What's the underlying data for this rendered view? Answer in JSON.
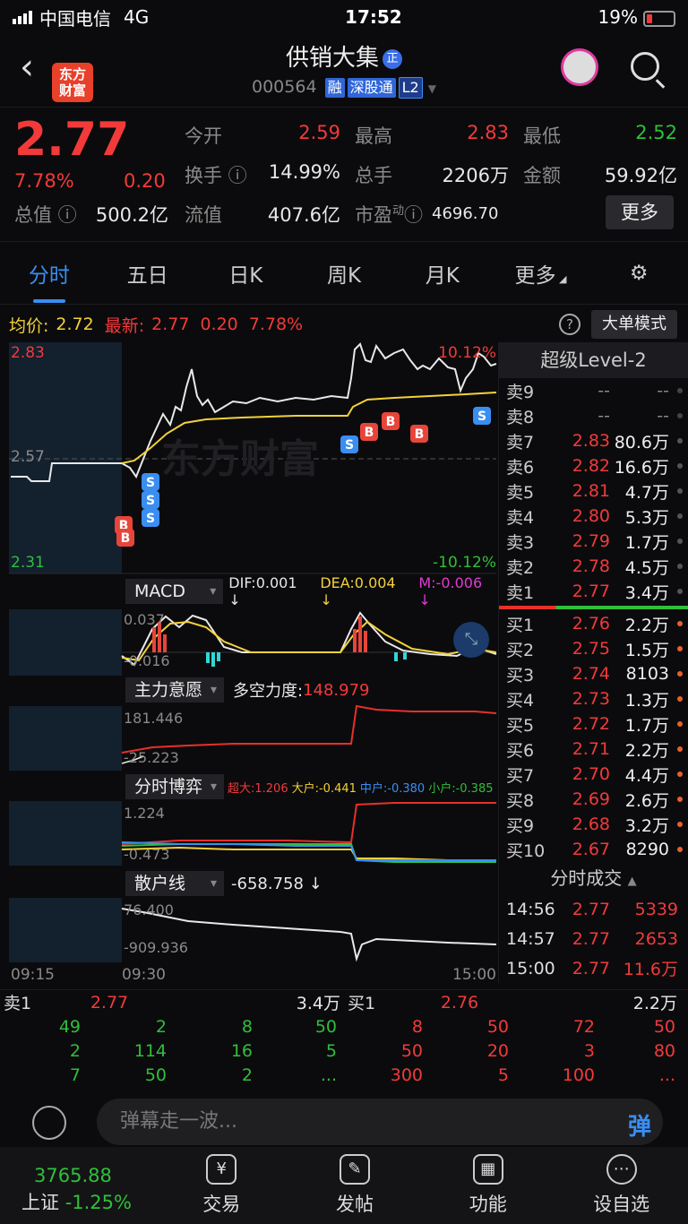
{
  "status": {
    "carrier": "中国电信",
    "network": "4G",
    "time": "17:52",
    "battery": "19%"
  },
  "header": {
    "logo_line1": "东方",
    "logo_line2": "财富",
    "name": "供销大集",
    "name_tag": "正",
    "code": "000564",
    "tags": [
      "融",
      "深股通",
      "L2"
    ]
  },
  "quote": {
    "price": "2.77",
    "pct": "7.78%",
    "change": "0.20",
    "open_label": "今开",
    "open": "2.59",
    "high_label": "最高",
    "high": "2.83",
    "low_label": "最低",
    "low": "2.52",
    "turnover_label": "换手",
    "turnover": "14.99%",
    "vol_label": "总手",
    "vol": "2206万",
    "amount_label": "金额",
    "amount": "59.92亿",
    "mcap_label": "总值",
    "mcap": "500.2亿",
    "float_label": "流值",
    "float": "407.6亿",
    "pe_label": "市盈",
    "pe_sup": "动",
    "pe": "4696.70",
    "more": "更多"
  },
  "tabs": [
    "分时",
    "五日",
    "日K",
    "周K",
    "月K",
    "更多",
    "⚙"
  ],
  "avgline": {
    "avg_label": "均价:",
    "avg": "2.72",
    "last_label": "最新:",
    "last": "2.77",
    "chg": "0.20",
    "pct": "7.78%",
    "help": "?",
    "mode": "大单模式"
  },
  "chart": {
    "ymax": "2.83",
    "ymid": "2.57",
    "ymin": "2.31",
    "pmax": "10.12%",
    "pmin": "-10.12%",
    "watermark": "东方财富",
    "times": [
      "09:15",
      "09:30",
      "15:00"
    ]
  },
  "macd": {
    "name": "MACD",
    "dif": "DIF:0.001 ↓",
    "dea": "DEA:0.004 ↓",
    "m": "M:-0.006 ↓",
    "top": "0.037",
    "bottom": "-0.016"
  },
  "zlyy": {
    "name": "主力意愿",
    "label": "多空力度:",
    "value": "148.979",
    "top": "181.446",
    "bottom": "-25.223"
  },
  "fsby": {
    "name": "分时博弈",
    "super": "超大:1.206",
    "big": "大户:-0.441",
    "mid": "中户:-0.380",
    "small": "小户:-0.385",
    "top": "1.224",
    "bottom": "-0.473"
  },
  "shx": {
    "name": "散户线",
    "value": "-658.758 ↓",
    "top": "76.400",
    "bottom": "-909.936"
  },
  "book": {
    "title": "超级Level-2",
    "asks": [
      {
        "l": "卖9",
        "p": "--",
        "v": "--"
      },
      {
        "l": "卖8",
        "p": "--",
        "v": "--"
      },
      {
        "l": "卖7",
        "p": "2.83",
        "v": "80.6万"
      },
      {
        "l": "卖6",
        "p": "2.82",
        "v": "16.6万"
      },
      {
        "l": "卖5",
        "p": "2.81",
        "v": "4.7万"
      },
      {
        "l": "卖4",
        "p": "2.80",
        "v": "5.3万"
      },
      {
        "l": "卖3",
        "p": "2.79",
        "v": "1.7万"
      },
      {
        "l": "卖2",
        "p": "2.78",
        "v": "4.5万"
      },
      {
        "l": "卖1",
        "p": "2.77",
        "v": "3.4万"
      }
    ],
    "bids": [
      {
        "l": "买1",
        "p": "2.76",
        "v": "2.2万"
      },
      {
        "l": "买2",
        "p": "2.75",
        "v": "1.5万"
      },
      {
        "l": "买3",
        "p": "2.74",
        "v": "8103"
      },
      {
        "l": "买4",
        "p": "2.73",
        "v": "1.3万"
      },
      {
        "l": "买5",
        "p": "2.72",
        "v": "1.7万"
      },
      {
        "l": "买6",
        "p": "2.71",
        "v": "2.2万"
      },
      {
        "l": "买7",
        "p": "2.70",
        "v": "4.4万"
      },
      {
        "l": "买8",
        "p": "2.69",
        "v": "2.6万"
      },
      {
        "l": "买9",
        "p": "2.68",
        "v": "3.2万"
      },
      {
        "l": "买10",
        "p": "2.67",
        "v": "8290"
      }
    ],
    "trades_title": "分时成交",
    "trades": [
      {
        "t": "14:56",
        "p": "2.77",
        "v": "5339"
      },
      {
        "t": "14:57",
        "p": "2.77",
        "v": "2653"
      },
      {
        "t": "15:00",
        "p": "2.77",
        "v": "11.6万"
      }
    ]
  },
  "queue": {
    "ask_label": "卖1",
    "ask_price": "2.77",
    "ask_vol": "3.4万",
    "bid_label": "买1",
    "bid_price": "2.76",
    "bid_vol": "2.2万",
    "ask_rows": [
      [
        "49",
        "2",
        "8",
        "50"
      ],
      [
        "2",
        "114",
        "16",
        "5"
      ],
      [
        "7",
        "50",
        "2",
        "..."
      ]
    ],
    "bid_rows": [
      [
        "8",
        "50",
        "72",
        "50"
      ],
      [
        "50",
        "20",
        "3",
        "80"
      ],
      [
        "300",
        "5",
        "100",
        "..."
      ]
    ]
  },
  "danmu": {
    "placeholder": "弹幕走一波...",
    "btn": "弹"
  },
  "tabbar": {
    "index_value": "3765.88",
    "index_name": "上证",
    "index_pct": "-1.25%",
    "items": [
      "交易",
      "发帖",
      "功能",
      "设自选"
    ]
  }
}
